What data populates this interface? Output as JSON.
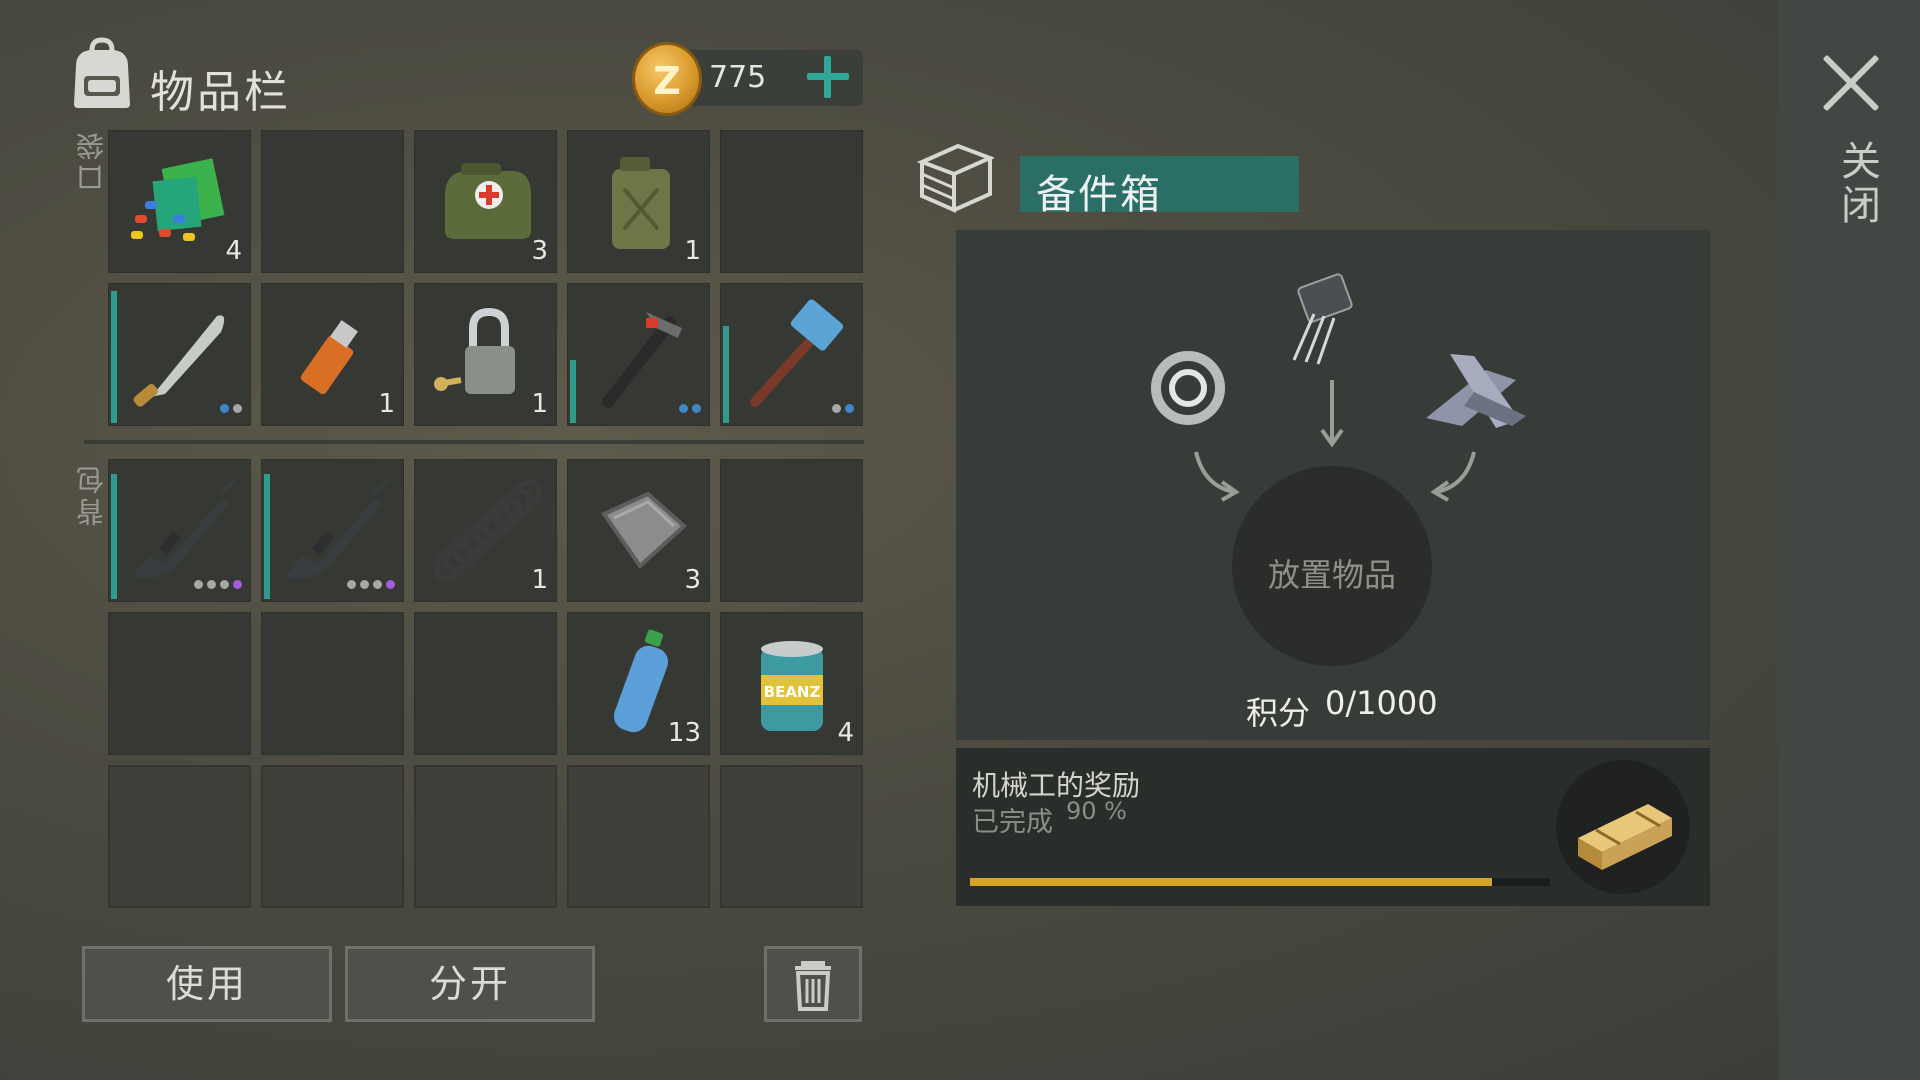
{
  "header": {
    "title": "物品栏",
    "coins": "775"
  },
  "close": {
    "label": "关闭"
  },
  "sections": {
    "pocket": "口袋",
    "backpack": "背包"
  },
  "pocket_slots": [
    {
      "name": "slot-paint-kit",
      "qty": "4",
      "icon": "colorful-kit-icon"
    },
    {
      "name": "slot-empty",
      "qty": "",
      "icon": ""
    },
    {
      "name": "slot-first-aid-bag",
      "qty": "3",
      "icon": "first-aid-bag-icon"
    },
    {
      "name": "slot-jerrycan",
      "qty": "1",
      "icon": "jerrycan-icon"
    },
    {
      "name": "slot-empty",
      "qty": "",
      "icon": ""
    },
    {
      "name": "slot-machete",
      "qty": "",
      "icon": "machete-icon",
      "durability": 0.95,
      "dots": [
        "b",
        "g"
      ]
    },
    {
      "name": "slot-usb",
      "qty": "1",
      "icon": "usb-drive-icon"
    },
    {
      "name": "slot-padlock",
      "qty": "1",
      "icon": "padlock-icon"
    },
    {
      "name": "slot-hammer",
      "qty": "",
      "icon": "hammer-icon",
      "durability": 0.45,
      "dots": [
        "b",
        "b"
      ]
    },
    {
      "name": "slot-sledgehammer",
      "qty": "",
      "icon": "sledgehammer-icon",
      "durability": 0.7,
      "dots": [
        "g",
        "b"
      ]
    }
  ],
  "backpack_slots": [
    {
      "name": "slot-rifle-1",
      "qty": "",
      "icon": "rifle-icon",
      "durability": 0.9,
      "dots": [
        "g",
        "g",
        "g",
        "p"
      ]
    },
    {
      "name": "slot-rifle-2",
      "qty": "",
      "icon": "rifle-icon",
      "durability": 0.9,
      "dots": [
        "g",
        "g",
        "g",
        "p"
      ]
    },
    {
      "name": "slot-spring",
      "qty": "1",
      "icon": "spring-icon"
    },
    {
      "name": "slot-metal-plate",
      "qty": "3",
      "icon": "metal-plate-icon"
    },
    {
      "name": "slot-empty",
      "qty": "",
      "icon": ""
    },
    {
      "name": "slot-empty",
      "qty": "",
      "icon": ""
    },
    {
      "name": "slot-empty",
      "qty": "",
      "icon": ""
    },
    {
      "name": "slot-empty",
      "qty": "",
      "icon": ""
    },
    {
      "name": "slot-water-bottle",
      "qty": "13",
      "icon": "water-bottle-icon"
    },
    {
      "name": "slot-beans-can",
      "qty": "4",
      "icon": "beans-can-icon",
      "can_text": "BEANZ"
    }
  ],
  "locked_slots_count": 5,
  "buttons": {
    "use": "使用",
    "split": "分开",
    "trash_icon": "trash-icon"
  },
  "spare_box": {
    "title": "备件箱",
    "drop_label": "放置物品",
    "score_label": "积分",
    "score_value": "0/1000",
    "ingredients": [
      "bearing-icon",
      "transistor-icon",
      "metal-scraps-icon"
    ]
  },
  "reward": {
    "title": "机械工的奖励",
    "status": "已完成",
    "percent_text": "90 %",
    "progress": 0.9,
    "crate_icon": "weapon-crate-icon"
  },
  "colors": {
    "teal": "#2b6e66",
    "accent_plus": "#2fa89a",
    "progress": "#d4a426",
    "coin": "#d99a2c"
  }
}
